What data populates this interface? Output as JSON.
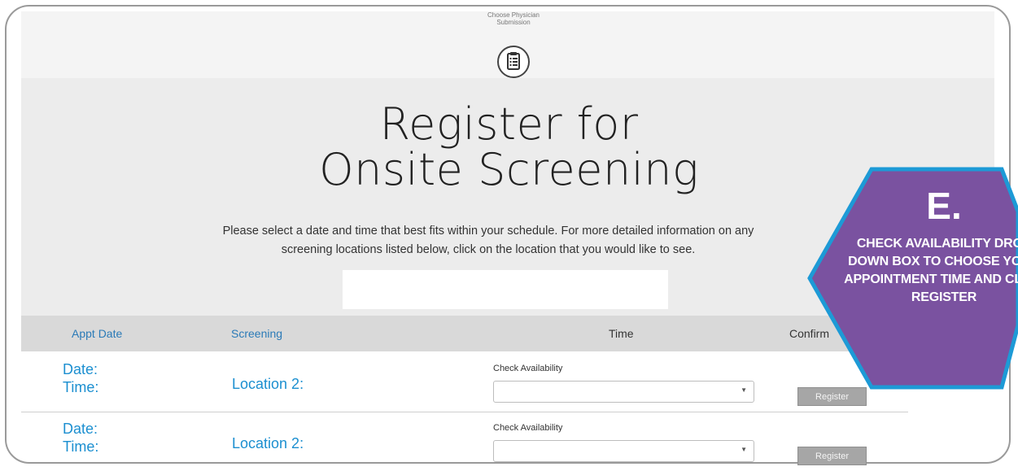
{
  "step": {
    "label": "Choose Physician\nSubmission",
    "icon": "clipboard-icon"
  },
  "page_title": {
    "line1": "Register for",
    "line2": "Onsite Screening"
  },
  "instructions": {
    "line1": "Please select a date and time that best fits within your schedule. For more detailed information on any",
    "line2": "screening locations listed below, click on the location that you would like to see."
  },
  "table": {
    "headers": {
      "appt_date": "Appt Date",
      "screening": "Screening",
      "time": "Time",
      "confirm": "Confirm"
    },
    "rows": [
      {
        "date_label": "Date:",
        "time_label": "Time:",
        "location": "Location 2:",
        "availability_label": "Check Availability",
        "select_value": "",
        "button": "Register"
      },
      {
        "date_label": "Date:",
        "time_label": "Time:",
        "location": "Location 2:",
        "availability_label": "Check Availability",
        "select_value": "",
        "button": "Register"
      }
    ]
  },
  "callout": {
    "letter": "E.",
    "text": "Check Availability drop down box to choose your appointment time and click Register",
    "colors": {
      "fill": "#7a52a0",
      "border": "#1d9ad6"
    }
  },
  "colors": {
    "link": "#2a7ab7",
    "accent": "#1c8fd0",
    "button": "#a6a6a6"
  }
}
